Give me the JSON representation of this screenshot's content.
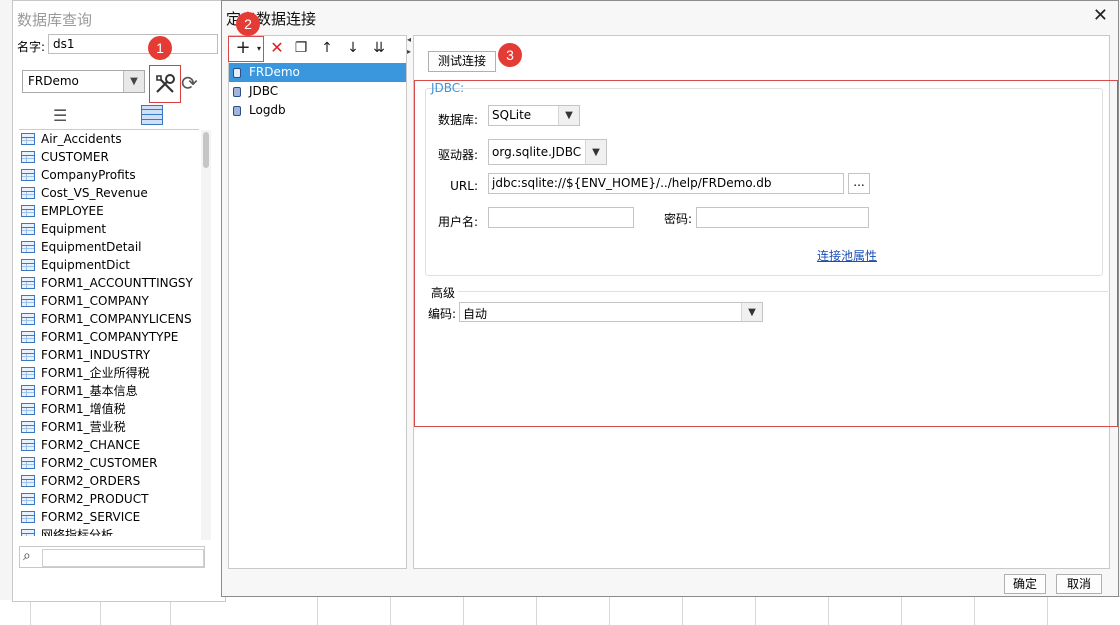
{
  "left_window": {
    "title": "数据库查询",
    "name_label": "名字:",
    "name_value": "ds1",
    "connection_selected": "FRDemo",
    "tables": [
      "Air_Accidents",
      "CUSTOMER",
      "CompanyProfits",
      "Cost_VS_Revenue",
      "EMPLOYEE",
      "Equipment",
      "EquipmentDetail",
      "EquipmentDict",
      "FORM1_ACCOUNTTINGSY",
      "FORM1_COMPANY",
      "FORM1_COMPANYLICENS",
      "FORM1_COMPANYTYPE",
      "FORM1_INDUSTRY",
      "FORM1_企业所得税",
      "FORM1_基本信息",
      "FORM1_增值税",
      "FORM1_营业税",
      "FORM2_CHANCE",
      "FORM2_CUSTOMER",
      "FORM2_ORDERS",
      "FORM2_PRODUCT",
      "FORM2_SERVICE",
      "网络指标分析"
    ]
  },
  "dialog": {
    "title": "定义数据连接",
    "connections": [
      {
        "label": "FRDemo",
        "selected": true
      },
      {
        "label": "JDBC",
        "selected": false
      },
      {
        "label": "Logdb",
        "selected": false
      }
    ],
    "test_button": "测试连接",
    "jdbc_legend": "JDBC:",
    "database_label": "数据库:",
    "database_value": "SQLite",
    "driver_label": "驱动器:",
    "driver_value": "org.sqlite.JDBC",
    "url_label": "URL:",
    "url_value": "jdbc:sqlite://${ENV_HOME}/../help/FRDemo.db",
    "browse_label": "...",
    "username_label": "用户名:",
    "username_value": "",
    "password_label": "密码:",
    "password_value": "",
    "pool_link": "连接池属性",
    "advanced_label": "高级",
    "encoding_label": "编码:",
    "encoding_value": "自动",
    "ok_button": "确定",
    "cancel_button": "取消"
  },
  "badges": [
    "1",
    "2",
    "3"
  ],
  "colors": {
    "selection": "#3a96dd",
    "badge": "#e53b35",
    "highlight_box": "#d94a4a",
    "link": "#1a4fb5"
  }
}
